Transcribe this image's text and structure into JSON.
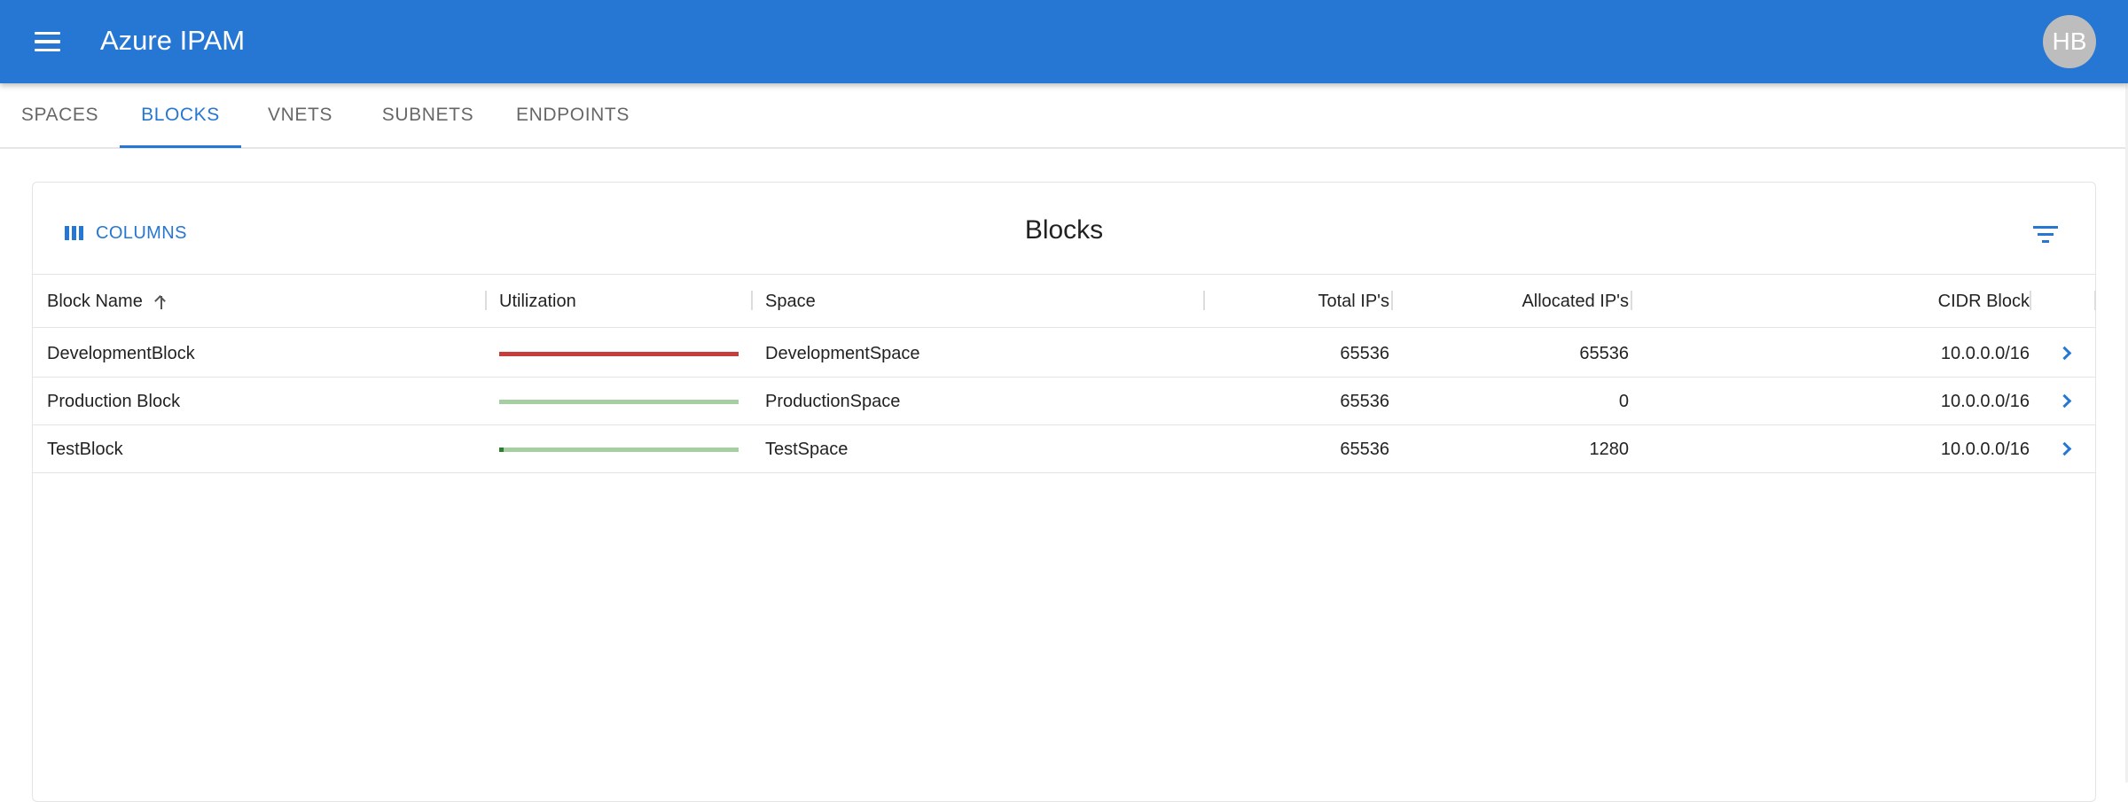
{
  "app": {
    "title": "Azure IPAM",
    "avatar_initials": "HB"
  },
  "colors": {
    "primary": "#2677d4",
    "full": "#c83c3c",
    "track": "#a5cfa0",
    "used_green": "#2e7d32"
  },
  "tabs": [
    {
      "label": "SPACES",
      "active": false
    },
    {
      "label": "BLOCKS",
      "active": true
    },
    {
      "label": "VNETS",
      "active": false
    },
    {
      "label": "SUBNETS",
      "active": false
    },
    {
      "label": "ENDPOINTS",
      "active": false
    }
  ],
  "toolbar": {
    "columns_label": "COLUMNS",
    "title": "Blocks",
    "filter_icon": "filter-icon"
  },
  "columns": {
    "name": "Block Name",
    "utilization": "Utilization",
    "space": "Space",
    "total": "Total IP's",
    "allocated": "Allocated IP's",
    "cidr": "CIDR Block"
  },
  "sort": {
    "column": "name",
    "direction": "asc"
  },
  "rows": [
    {
      "name": "DevelopmentBlock",
      "space": "DevelopmentSpace",
      "total": "65536",
      "allocated": "65536",
      "cidr": "10.0.0.0/16",
      "utilization": 1.0
    },
    {
      "name": "Production Block",
      "space": "ProductionSpace",
      "total": "65536",
      "allocated": "0",
      "cidr": "10.0.0.0/16",
      "utilization": 0.0
    },
    {
      "name": "TestBlock",
      "space": "TestSpace",
      "total": "65536",
      "allocated": "1280",
      "cidr": "10.0.0.0/16",
      "utilization": 0.0195
    }
  ]
}
